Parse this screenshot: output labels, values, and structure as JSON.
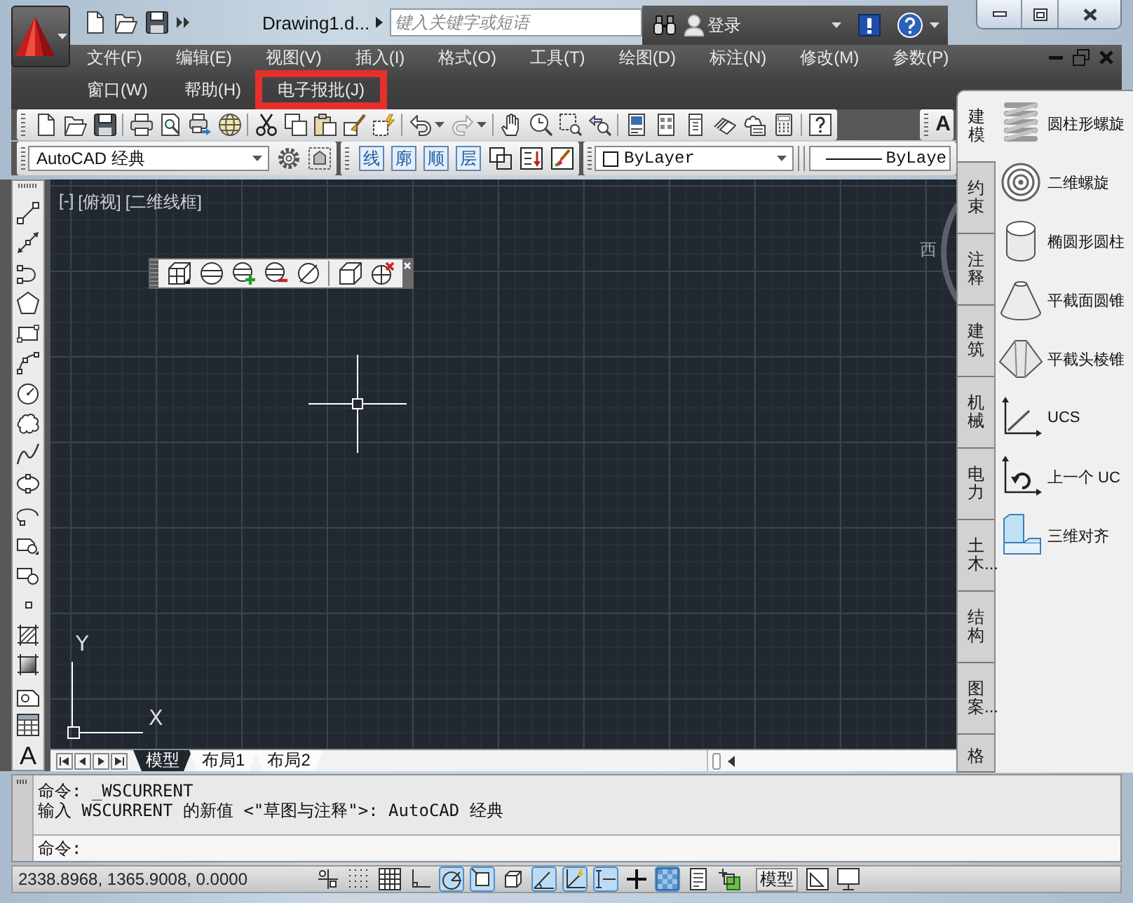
{
  "title_bar": {
    "document_title": "Drawing1.d...",
    "search": {
      "placeholder": "键入关键字或短语"
    },
    "sign_in": "登录"
  },
  "menu_bar": {
    "rows": [
      [
        {
          "label": "文件(F)",
          "highlighted": false
        },
        {
          "label": "编辑(E)",
          "highlighted": false
        },
        {
          "label": "视图(V)",
          "highlighted": false
        },
        {
          "label": "插入(I)",
          "highlighted": false
        },
        {
          "label": "格式(O)",
          "highlighted": false
        },
        {
          "label": "工具(T)",
          "highlighted": false
        },
        {
          "label": "绘图(D)",
          "highlighted": false
        },
        {
          "label": "标注(N)",
          "highlighted": false
        },
        {
          "label": "修改(M)",
          "highlighted": false
        },
        {
          "label": "参数(P)",
          "highlighted": false
        }
      ],
      [
        {
          "label": "窗口(W)",
          "highlighted": false
        },
        {
          "label": "帮助(H)",
          "highlighted": false
        },
        {
          "label": "电子报批(J)",
          "highlighted": true
        }
      ]
    ]
  },
  "text_style_toolbar": {
    "label": "A"
  },
  "workspace_toolbar": {
    "workspace": "AutoCAD 经典"
  },
  "quick_buttons": [
    "线",
    "廓",
    "顺",
    "层"
  ],
  "properties_toolbar": {
    "color_setting": "ByLayer",
    "linetype": "ByLaye"
  },
  "draw_toolbar": {
    "text_tool": "A"
  },
  "viewport": {
    "controls": [
      "[-]",
      "[俯视]",
      "[二维线框]"
    ],
    "viewcube_label": "西",
    "axis_labels": [
      "Y",
      "X"
    ]
  },
  "layout_tabs": [
    {
      "label": "模型",
      "selected": true
    },
    {
      "label": "布局1",
      "selected": false
    },
    {
      "label": "布局2",
      "selected": false
    }
  ],
  "command_line": {
    "history": [
      "命令: _WSCURRENT",
      "输入 WSCURRENT 的新值 <\"草图与注释\">: AutoCAD 经典"
    ],
    "prompt": "命令:"
  },
  "status_bar": {
    "coordinates": "2338.8968, 1365.9008, 0.0000",
    "toggles": [
      {
        "on": false
      },
      {
        "on": false
      },
      {
        "on": false
      },
      {
        "on": false
      },
      {
        "on": true
      },
      {
        "on": true
      },
      {
        "on": false
      },
      {
        "on": true
      },
      {
        "on": true
      },
      {
        "on": true
      },
      {
        "on": false
      },
      {
        "on": true
      },
      {
        "on": false
      },
      {
        "on": false
      }
    ],
    "model_button": "模型"
  },
  "tool_palette": {
    "tabs": [
      {
        "label": "建模",
        "selected": true
      },
      {
        "label": "约束",
        "selected": false
      },
      {
        "label": "注释",
        "selected": false
      },
      {
        "label": "建筑",
        "selected": false
      },
      {
        "label": "机械",
        "selected": false
      },
      {
        "label": "电力",
        "selected": false
      },
      {
        "label": "土木...",
        "selected": false
      },
      {
        "label": "结构",
        "selected": false
      },
      {
        "label": "图案...",
        "selected": false
      },
      {
        "label": "格",
        "selected": false
      }
    ],
    "items": [
      {
        "label": "圆柱形螺旋"
      },
      {
        "label": "二维螺旋"
      },
      {
        "label": "椭圆形圆柱"
      },
      {
        "label": "平截面圆锥"
      },
      {
        "label": "平截头棱锥"
      },
      {
        "label": "UCS"
      },
      {
        "label": "上一个 UC"
      },
      {
        "label": "三维对齐"
      }
    ]
  }
}
